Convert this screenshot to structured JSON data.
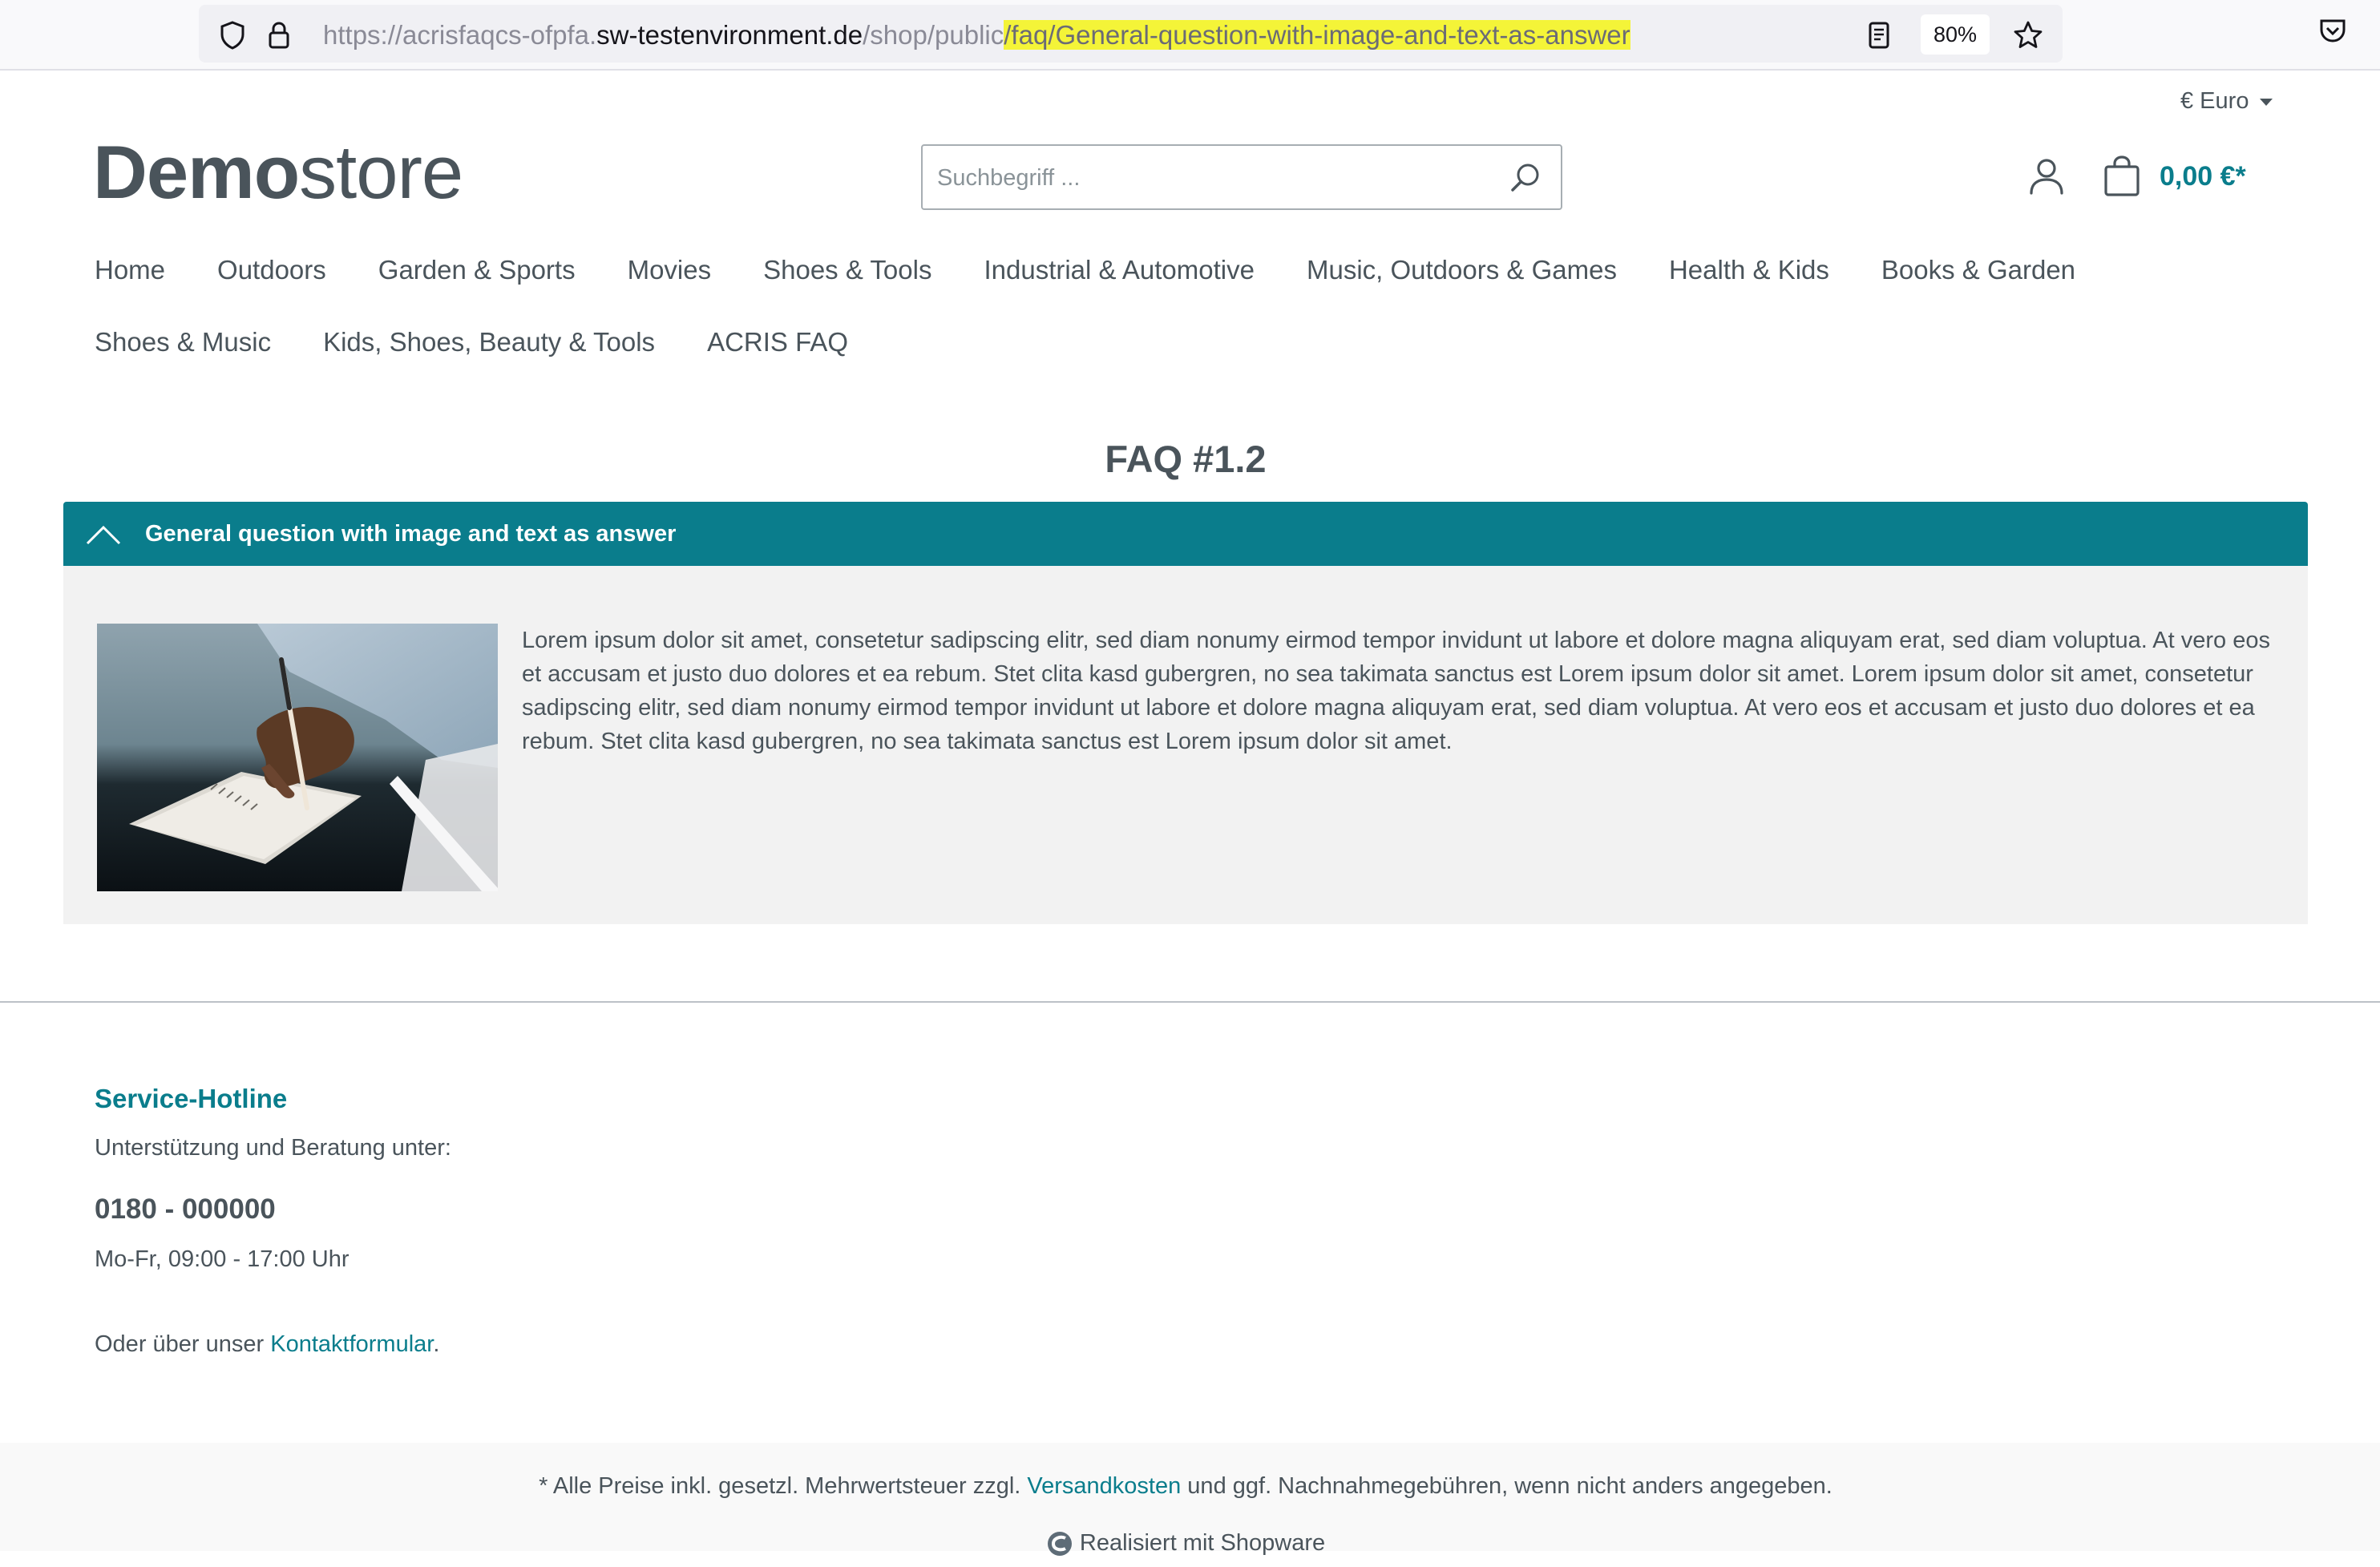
{
  "browser": {
    "url_prefix": "https://acrisfaqcs-ofpfa.",
    "url_host": "sw-testenvironment.de",
    "url_path": "/shop/public",
    "url_highlighted": "/faq/General-question-with-image-and-text-as-answer",
    "zoom": "80%",
    "icons": [
      "shield-icon",
      "lock-icon",
      "reader-view-icon",
      "bookmark-star-icon",
      "pocket-icon"
    ],
    "highlight_color": "#f4f438"
  },
  "header": {
    "currency": "€ Euro",
    "logo_bold": "Demo",
    "logo_light": "store",
    "search_placeholder": "Suchbegriff ...",
    "cart_total": "0,00 €*",
    "accent_color": "#0a7d8c"
  },
  "nav": {
    "row1": [
      "Home",
      "Outdoors",
      "Garden & Sports",
      "Movies",
      "Shoes & Tools",
      "Industrial & Automotive",
      "Music, Outdoors & Games",
      "Health & Kids",
      "Books & Garden"
    ],
    "row2": [
      "Shoes & Music",
      "Kids, Shoes, Beauty & Tools",
      "ACRIS FAQ"
    ]
  },
  "faq": {
    "title": "FAQ #1.2",
    "question": "General question with image and text as answer",
    "answer": "Lorem ipsum dolor sit amet, consetetur sadipscing elitr, sed diam nonumy eirmod tempor invidunt ut labore et dolore magna aliquyam erat, sed diam voluptua. At vero eos et accusam et justo duo dolores et ea rebum. Stet clita kasd gubergren, no sea takimata sanctus est Lorem ipsum dolor sit amet. Lorem ipsum dolor sit amet, consetetur sadipscing elitr, sed diam nonumy eirmod tempor invidunt ut labore et dolore magna aliquyam erat, sed diam voluptua. At vero eos et accusam et justo duo dolores et ea rebum. Stet clita kasd gubergren, no sea takimata sanctus est Lorem ipsum dolor sit amet.",
    "expanded": true
  },
  "footer": {
    "hotline_title": "Service-Hotline",
    "hotline_sub": "Unterstützung und Beratung unter:",
    "phone": "0180 - 000000",
    "hours": "Mo-Fr, 09:00 - 17:00 Uhr",
    "contact_prefix": "Oder über unser ",
    "contact_link": "Kontaktformular",
    "contact_suffix": ".",
    "vat_prefix": "* Alle Preise inkl. gesetzl. Mehrwertsteuer zzgl. ",
    "vat_link": "Versandkosten",
    "vat_suffix": " und ggf. Nachnahmegebühren, wenn nicht anders angegeben.",
    "realized": "Realisiert mit Shopware"
  }
}
